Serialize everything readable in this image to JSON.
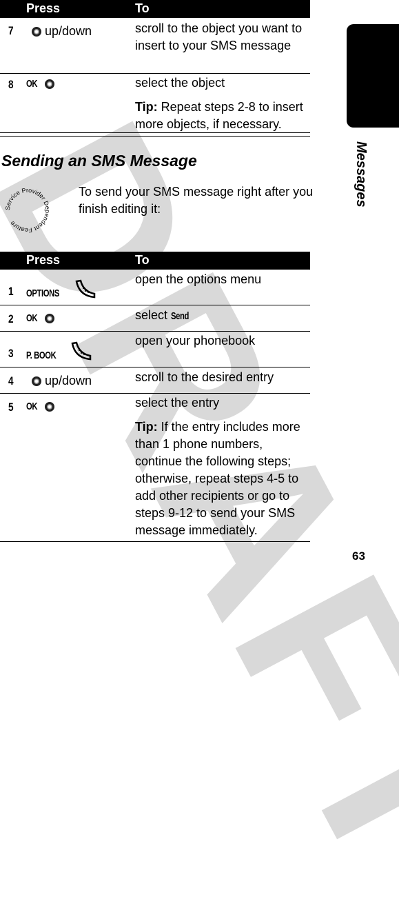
{
  "watermark": "DRAFT",
  "side_tab": {
    "label": "Messages"
  },
  "page_number": "63",
  "table1": {
    "headers": [
      "Press",
      "To"
    ],
    "rows": [
      {
        "num": "7",
        "key": "",
        "icon": "nav-key-icon",
        "press_text": "up/down",
        "to": "scroll to the object you want to insert to your SMS message",
        "tip_label": "",
        "tip": ""
      },
      {
        "num": "8",
        "key": "OK",
        "icon": "nav-key-icon",
        "press_text": "",
        "to": "select the object",
        "tip_label": "Tip:",
        "tip": " Repeat steps 2-8 to insert more objects, if necessary."
      }
    ]
  },
  "section": {
    "title": "Sending an SMS Message",
    "intro": "To send your SMS message right after you finish editing it:",
    "stamp": "Service Provider Dependent Feature"
  },
  "table2": {
    "headers": [
      "Press",
      "To"
    ],
    "rows": [
      {
        "num": "1",
        "key": "OPTIONS",
        "icon": "soft-key-icon",
        "press_text": "",
        "to": "open the options menu"
      },
      {
        "num": "2",
        "key": "OK",
        "icon": "nav-key-icon",
        "press_text": "",
        "to_pre": "select ",
        "to_key": "Send"
      },
      {
        "num": "3",
        "key": "P. BOOK",
        "icon": "soft-key-icon",
        "press_text": "",
        "to": "open your phonebook"
      },
      {
        "num": "4",
        "key": "",
        "icon": "nav-key-icon",
        "press_text": "up/down",
        "to": "scroll to the desired entry"
      },
      {
        "num": "5",
        "key": "OK",
        "icon": "nav-key-icon",
        "press_text": "",
        "to": "select the entry",
        "tip_label": "Tip:",
        "tip": " If the entry includes more than 1 phone numbers, continue the following steps; otherwise, repeat steps 4-5 to add other recipients or go to steps 9-12 to send your SMS message immediately."
      }
    ]
  }
}
